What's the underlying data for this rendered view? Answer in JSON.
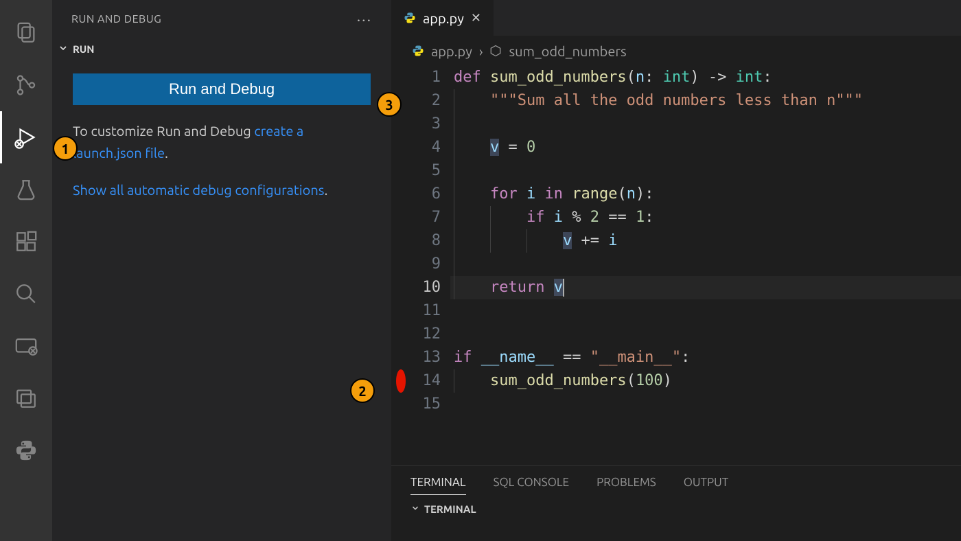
{
  "activity_bar": {
    "items": [
      "explorer",
      "source-control",
      "run-debug",
      "testing",
      "extensions",
      "search",
      "remote",
      "window-layout",
      "python"
    ],
    "active": "run-debug"
  },
  "sidebar": {
    "title": "RUN AND DEBUG",
    "section_label": "RUN",
    "run_button": "Run and Debug",
    "hint_prefix": "To customize Run and Debug ",
    "hint_link": "create a launch.json file",
    "hint_suffix": ".",
    "configs_link": "Show all automatic debug configurations",
    "configs_suffix": "."
  },
  "editor": {
    "tab": {
      "label": "app.py",
      "icon": "python-icon"
    },
    "breadcrumbs": {
      "file": "app.py",
      "symbol": "sum_odd_numbers"
    },
    "breakpoints": {
      "14": true
    },
    "cursor_line": 10,
    "code": {
      "lines": [
        {
          "n": 1,
          "tokens": [
            [
              "k",
              "def "
            ],
            [
              "fn",
              "sum_odd_numbers"
            ],
            [
              "op",
              "("
            ],
            [
              "pm",
              "n"
            ],
            [
              "op",
              ": "
            ],
            [
              "ty",
              "int"
            ],
            [
              "op",
              ") -> "
            ],
            [
              "ty",
              "int"
            ],
            [
              "op",
              ":"
            ]
          ]
        },
        {
          "n": 2,
          "indent": 1,
          "tokens": [
            [
              "s",
              "\"\"\"Sum all the odd numbers less than n\"\"\""
            ]
          ]
        },
        {
          "n": 3,
          "indent": 1,
          "tokens": []
        },
        {
          "n": 4,
          "indent": 1,
          "tokens": [
            [
              "pm hl",
              "v"
            ],
            [
              "op",
              " = "
            ],
            [
              "n",
              "0"
            ]
          ]
        },
        {
          "n": 5,
          "indent": 1,
          "tokens": []
        },
        {
          "n": 6,
          "indent": 1,
          "tokens": [
            [
              "k",
              "for "
            ],
            [
              "pm",
              "i"
            ],
            [
              "k",
              " in "
            ],
            [
              "fn",
              "range"
            ],
            [
              "op",
              "("
            ],
            [
              "pm",
              "n"
            ],
            [
              "op",
              "):"
            ]
          ]
        },
        {
          "n": 7,
          "indent": 2,
          "tokens": [
            [
              "k",
              "if "
            ],
            [
              "pm",
              "i"
            ],
            [
              "op",
              " % "
            ],
            [
              "n",
              "2"
            ],
            [
              "op",
              " == "
            ],
            [
              "n",
              "1"
            ],
            [
              "op",
              ":"
            ]
          ]
        },
        {
          "n": 8,
          "indent": 3,
          "tokens": [
            [
              "pm hl",
              "v"
            ],
            [
              "op",
              " += "
            ],
            [
              "pm",
              "i"
            ]
          ]
        },
        {
          "n": 9,
          "indent": 1,
          "tokens": []
        },
        {
          "n": 10,
          "indent": 1,
          "cur": true,
          "tokens": [
            [
              "k",
              "return "
            ],
            [
              "pm hl",
              "v"
            ],
            [
              "cursor",
              ""
            ]
          ]
        },
        {
          "n": 11,
          "tokens": []
        },
        {
          "n": 12,
          "tokens": []
        },
        {
          "n": 13,
          "tokens": [
            [
              "k",
              "if "
            ],
            [
              "pm",
              "__name__"
            ],
            [
              "op",
              " == "
            ],
            [
              "s",
              "\"__main__\""
            ],
            [
              "op",
              ":"
            ]
          ]
        },
        {
          "n": 14,
          "indent": 1,
          "tokens": [
            [
              "fn",
              "sum_odd_numbers"
            ],
            [
              "op",
              "("
            ],
            [
              "n",
              "100"
            ],
            [
              "op",
              ")"
            ]
          ]
        },
        {
          "n": 15,
          "tokens": []
        }
      ]
    }
  },
  "panel": {
    "tabs": [
      "TERMINAL",
      "SQL CONSOLE",
      "PROBLEMS",
      "OUTPUT"
    ],
    "active": "TERMINAL",
    "body_label": "TERMINAL"
  },
  "annotations": {
    "1": "Run and Debug activity bar icon",
    "2": "Breakpoint on line 14",
    "3": "Run and Debug button"
  }
}
